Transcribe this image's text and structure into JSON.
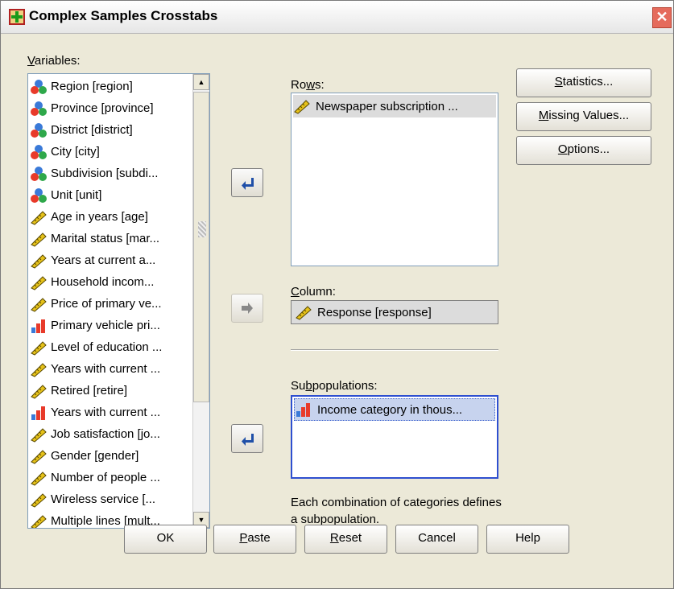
{
  "window": {
    "title": "Complex Samples Crosstabs",
    "close_glyph": "✕"
  },
  "variables": {
    "label_pre": "",
    "label_u": "V",
    "label_post": "ariables:",
    "items": [
      {
        "label": "Region [region]",
        "icon": "nominal-icon"
      },
      {
        "label": "Province [province]",
        "icon": "nominal-icon"
      },
      {
        "label": "District [district]",
        "icon": "nominal-icon"
      },
      {
        "label": "City [city]",
        "icon": "nominal-icon"
      },
      {
        "label": "Subdivision [subdi...",
        "icon": "nominal-icon"
      },
      {
        "label": "Unit [unit]",
        "icon": "nominal-icon"
      },
      {
        "label": "Age in years [age]",
        "icon": "scale-icon"
      },
      {
        "label": "Marital status [mar...",
        "icon": "scale-icon"
      },
      {
        "label": "Years at current a...",
        "icon": "scale-icon"
      },
      {
        "label": "Household incom...",
        "icon": "scale-icon"
      },
      {
        "label": "Price of primary ve...",
        "icon": "scale-icon"
      },
      {
        "label": "Primary vehicle pri...",
        "icon": "ordinal-icon"
      },
      {
        "label": "Level of education ...",
        "icon": "scale-icon"
      },
      {
        "label": "Years with current ...",
        "icon": "scale-icon"
      },
      {
        "label": "Retired [retire]",
        "icon": "scale-icon"
      },
      {
        "label": "Years with current ...",
        "icon": "ordinal-icon"
      },
      {
        "label": "Job satisfaction [jo...",
        "icon": "scale-icon"
      },
      {
        "label": "Gender [gender]",
        "icon": "scale-icon"
      },
      {
        "label": "Number of people ...",
        "icon": "scale-icon"
      },
      {
        "label": "Wireless service [...",
        "icon": "scale-icon"
      },
      {
        "label": "Multiple lines [mult...",
        "icon": "scale-icon"
      }
    ]
  },
  "rows": {
    "label_pre": "Ro",
    "label_u": "w",
    "label_post": "s:",
    "items": [
      {
        "label": "Newspaper subscription ...",
        "icon": "scale-icon"
      }
    ]
  },
  "column": {
    "label_pre": "",
    "label_u": "C",
    "label_post": "olumn:",
    "item": {
      "label": "Response [response]",
      "icon": "scale-icon"
    }
  },
  "subpopulations": {
    "label_pre": "Su",
    "label_u": "b",
    "label_post": "populations:",
    "items": [
      {
        "label": "Income category in thous...",
        "icon": "ordinal-icon"
      }
    ]
  },
  "note": "Each combination of categories defines a subpopulation.",
  "side_buttons": [
    {
      "pre": "",
      "u": "S",
      "post": "tatistics..."
    },
    {
      "pre": "",
      "u": "M",
      "post": "issing Values..."
    },
    {
      "pre": "",
      "u": "O",
      "post": "ptions..."
    }
  ],
  "bottom_buttons": [
    {
      "pre": "OK",
      "u": "",
      "post": ""
    },
    {
      "pre": "",
      "u": "P",
      "post": "aste"
    },
    {
      "pre": "",
      "u": "R",
      "post": "eset"
    },
    {
      "pre": "Cancel",
      "u": "",
      "post": ""
    },
    {
      "pre": "Help",
      "u": "",
      "post": ""
    }
  ]
}
